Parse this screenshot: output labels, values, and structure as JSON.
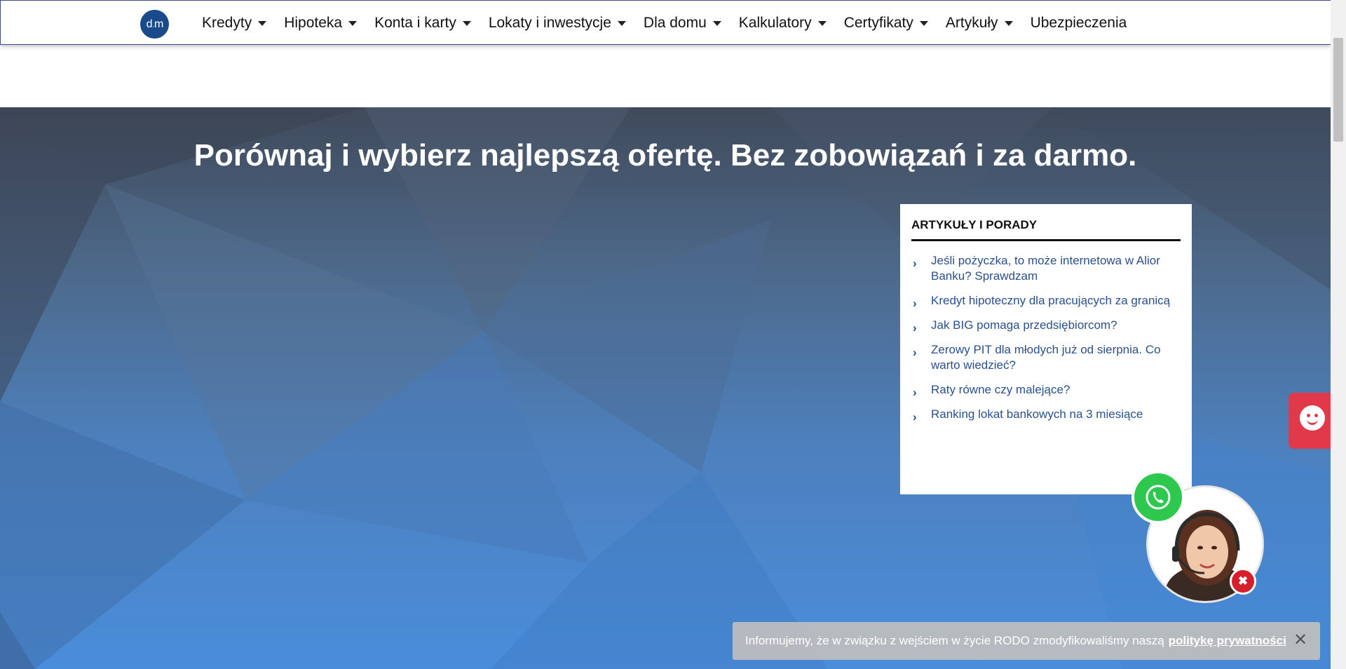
{
  "logo": {
    "text_left": "d",
    "text_dot": ".",
    "text_right": "m"
  },
  "nav": {
    "items": [
      {
        "label": "Kredyty",
        "dropdown": true
      },
      {
        "label": "Hipoteka",
        "dropdown": true
      },
      {
        "label": "Konta i karty",
        "dropdown": true
      },
      {
        "label": "Lokaty i inwestycje",
        "dropdown": true
      },
      {
        "label": "Dla domu",
        "dropdown": true
      },
      {
        "label": "Kalkulatory",
        "dropdown": true
      },
      {
        "label": "Certyfikaty",
        "dropdown": true
      },
      {
        "label": "Artykuły",
        "dropdown": true
      },
      {
        "label": "Ubezpieczenia",
        "dropdown": false
      }
    ]
  },
  "hero": {
    "title": "Porównaj i wybierz najlepszą ofertę. Bez zobowiązań i za darmo."
  },
  "articles": {
    "title": "ARTYKUŁY I PORADY",
    "items": [
      "Jeśli pożyczka, to może internetowa w Alior Banku? Sprawdzam",
      "Kredyt hipoteczny dla pracujących za granicą",
      "Jak BIG pomaga przedsiębiorcom?",
      "Zerowy PIT dla młodych już od sierpnia. Co warto wiedzieć?",
      "Raty równe czy malejące?",
      "Ranking lokat bankowych na 3 miesiące"
    ]
  },
  "notice": {
    "text": "Informujemy, że w związku z wejściem w życie RODO zmodyfikowaliśmy naszą",
    "link": "politykę prywatności",
    "close": "✕"
  },
  "widgets": {
    "close_symbol": "✖"
  },
  "colors": {
    "link": "#2b4f8c",
    "whatsapp": "#2dc84d",
    "chat_tab": "#e2394a",
    "close_red": "#d61f2b"
  }
}
